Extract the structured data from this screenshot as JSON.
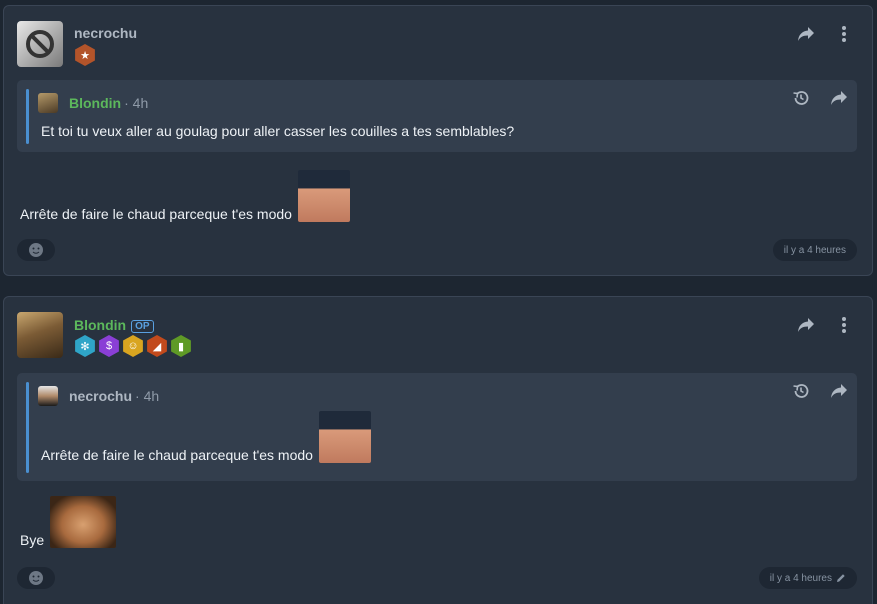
{
  "post1": {
    "username": "necrochu",
    "avatar_icon": "banned-icon",
    "badges": [
      {
        "icon": "star-icon",
        "color": "#b3542a"
      }
    ],
    "quote": {
      "username": "Blondin",
      "time": "· 4h",
      "text": "Et toi tu veux aller au goulag pour aller casser les couilles a tes semblables?"
    },
    "body_text": "Arrête de faire le chaud parceque t'es modo",
    "timestamp": "il y a 4 heures"
  },
  "post2": {
    "username": "Blondin",
    "op_label": "OP",
    "badges": [
      {
        "icon": "snowflake-icon",
        "color": "#2fa5c8"
      },
      {
        "icon": "dollar-icon",
        "color": "#8a3fd6"
      },
      {
        "icon": "smile-icon",
        "color": "#d9a520"
      },
      {
        "icon": "cheese-icon",
        "color": "#c24a1c"
      },
      {
        "icon": "beer-icon",
        "color": "#5f9a26"
      }
    ],
    "quote": {
      "username": "necrochu",
      "time": "· 4h",
      "text": "Arrête de faire le chaud parceque t'es modo"
    },
    "body_text": "Bye",
    "timestamp": "il y a 4 heures",
    "edited_icon": "pencil-icon"
  }
}
